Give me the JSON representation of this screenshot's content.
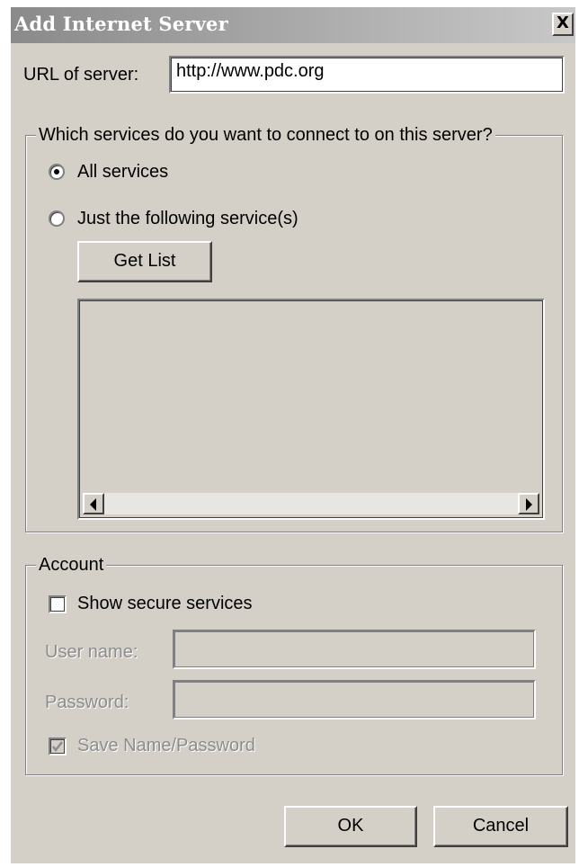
{
  "window": {
    "title": "Add Internet Server",
    "close_symbol": "X"
  },
  "url": {
    "label": "URL of  server:",
    "value": "http://www.pdc.org"
  },
  "services_group": {
    "caption": "Which services do you want to connect to on this server?",
    "option_all": {
      "label": "All services",
      "selected": true
    },
    "option_specific": {
      "label": "Just the following service(s)",
      "selected": false
    },
    "get_list_label": "Get List",
    "list_items": []
  },
  "account_group": {
    "caption": "Account",
    "show_secure_label": "Show secure services",
    "show_secure_checked": false,
    "user_name_label": "User name:",
    "user_name_value": "",
    "password_label": "Password:",
    "password_value": "",
    "save_label": "Save Name/Password",
    "save_checked": true
  },
  "buttons": {
    "ok_label": "OK",
    "cancel_label": "Cancel"
  },
  "icons": {
    "close": "close-icon",
    "scroll_left": "arrow-left-icon",
    "scroll_right": "arrow-right-icon",
    "check": "checkmark-icon"
  }
}
